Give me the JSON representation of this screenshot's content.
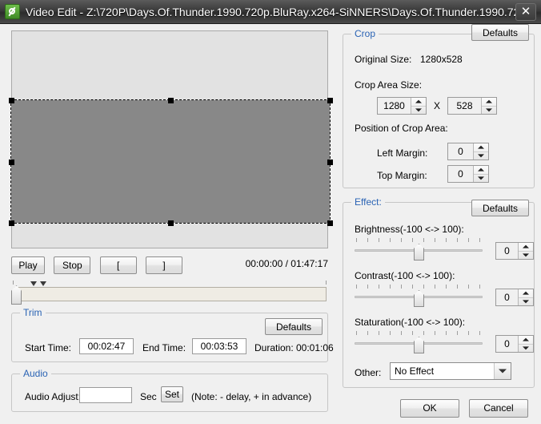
{
  "window": {
    "title": "Video Edit - Z:\\720P\\Days.Of.Thunder.1990.720p.BluRay.x264-SiNNERS\\Days.Of.Thunder.1990.72...",
    "icon": "video-edit-app-icon",
    "close_label": "✕"
  },
  "preview": {
    "crop_overlay_color": "#888888"
  },
  "playback": {
    "play_label": "Play",
    "stop_label": "Stop",
    "mark_in_label": "[",
    "mark_out_label": "]",
    "timecode": "00:00:00 / 01:47:17",
    "position_time": "00:00:00",
    "total_time": "01:47:17"
  },
  "trim": {
    "legend": "Trim",
    "defaults_label": "Defaults",
    "start_label": "Start Time:",
    "start_value": "00:02:47",
    "end_label": "End Time:",
    "end_value": "00:03:53",
    "duration_label": "Duration:",
    "duration_value": "00:01:06"
  },
  "audio": {
    "legend": "Audio",
    "adjust_label": "Audio Adjust:",
    "adjust_value": "",
    "adjust_placeholder": "",
    "unit_label": "Sec",
    "set_label": "Set",
    "note": "(Note: - delay, + in advance)"
  },
  "crop": {
    "legend": "Crop",
    "defaults_label": "Defaults",
    "original_size_label": "Original Size:",
    "original_size_value": "1280x528",
    "area_size_label": "Crop Area Size:",
    "width_value": "1280",
    "separator": "X",
    "height_value": "528",
    "position_label": "Position of Crop Area:",
    "left_margin_label": "Left Margin:",
    "left_margin_value": "0",
    "top_margin_label": "Top Margin:",
    "top_margin_value": "0"
  },
  "effect": {
    "legend": "Effect:",
    "defaults_label": "Defaults",
    "brightness_label": "Brightness(-100 <-> 100):",
    "brightness_value": "0",
    "contrast_label": "Contrast(-100 <-> 100):",
    "contrast_value": "0",
    "saturation_label": "Staturation(-100 <-> 100):",
    "saturation_value": "0",
    "other_label": "Other:",
    "other_value": "No Effect"
  },
  "dialog": {
    "ok_label": "OK",
    "cancel_label": "Cancel"
  },
  "colors": {
    "legend_blue": "#2a63b4",
    "titlebar_dark": "#3a3a3a",
    "dialog_face": "#f0f0f0"
  }
}
